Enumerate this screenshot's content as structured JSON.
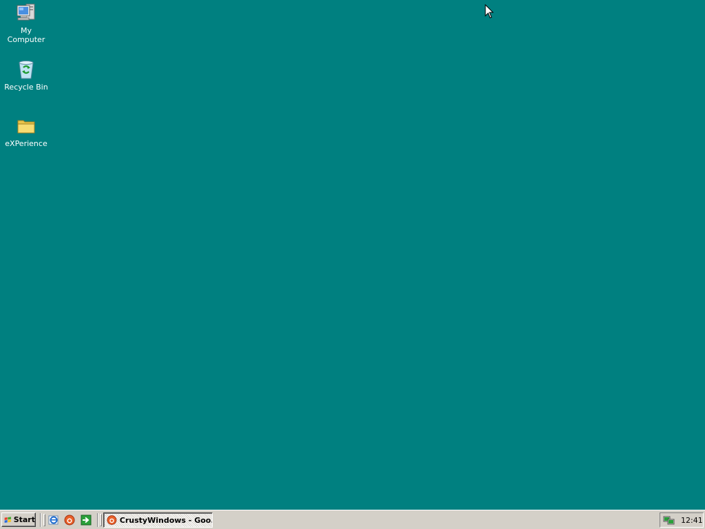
{
  "desktop": {
    "background_color": "#008080",
    "icons": [
      {
        "label": "My Computer",
        "icon": "my-computer-icon"
      },
      {
        "label": "Recycle Bin",
        "icon": "recycle-bin-icon"
      },
      {
        "label": "eXPerience",
        "icon": "folder-icon"
      }
    ]
  },
  "taskbar": {
    "start_label": "Start",
    "quick_launch": [
      {
        "icon": "internet-explorer-icon"
      },
      {
        "icon": "browser-icon"
      },
      {
        "icon": "green-arrow-icon"
      }
    ],
    "task_button_label": "CrustyWindows - Goo...",
    "tray": {
      "icon": "network-tray-icon",
      "clock": "12:41"
    }
  }
}
